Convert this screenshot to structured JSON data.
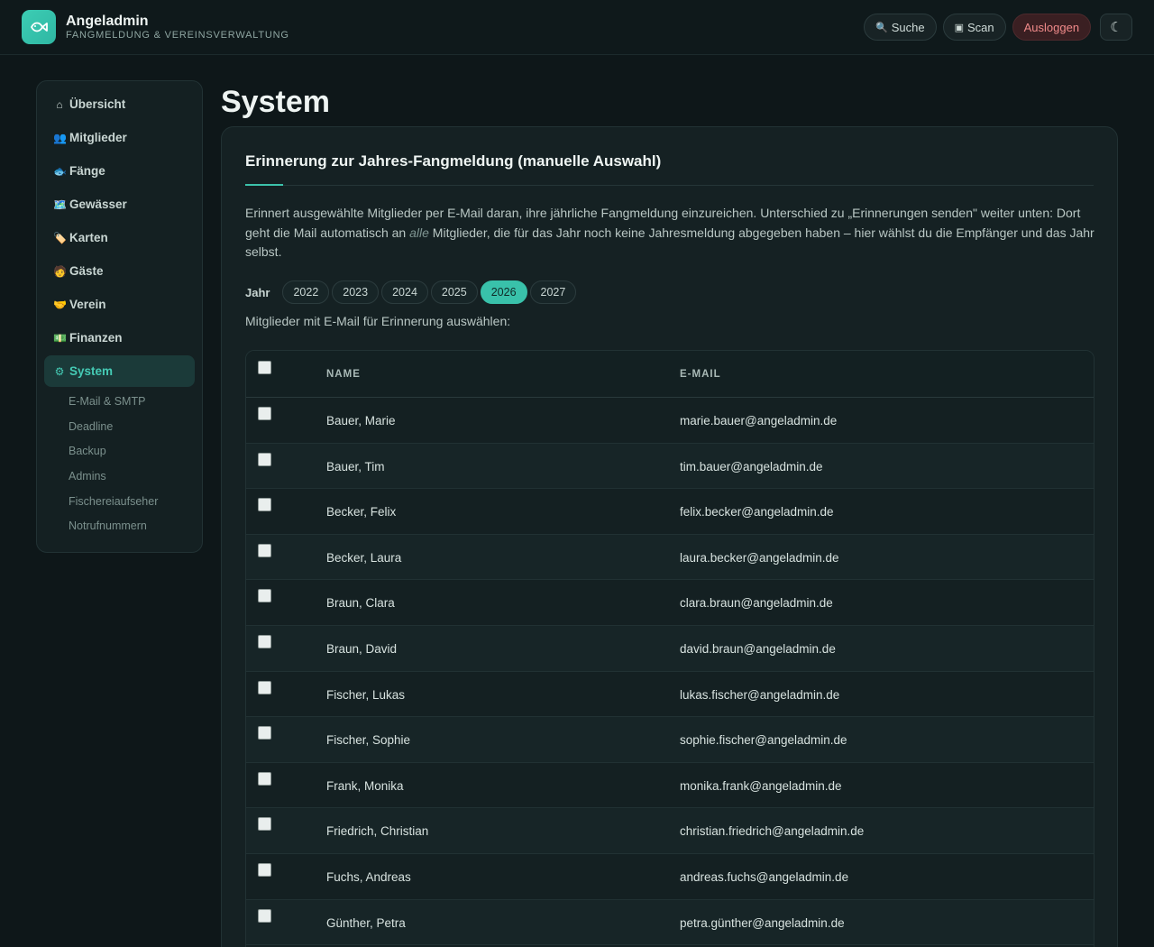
{
  "header": {
    "title": "Angeladmin",
    "subtitle": "FANGMELDUNG & VEREINSVERWALTUNG",
    "buttons": {
      "search": "Suche",
      "scan": "Scan",
      "logout": "Ausloggen"
    },
    "theme_toggle": "☾"
  },
  "sidebar": {
    "items": [
      {
        "icon": "⌂",
        "label": "Übersicht"
      },
      {
        "icon": "👥",
        "label": "Mitglieder"
      },
      {
        "icon": "🐟",
        "label": "Fänge"
      },
      {
        "icon": "🗺️",
        "label": "Gewässer"
      },
      {
        "icon": "🏷️",
        "label": "Karten"
      },
      {
        "icon": "🧑",
        "label": "Gäste"
      },
      {
        "icon": "🤝",
        "label": "Verein"
      },
      {
        "icon": "💵",
        "label": "Finanzen"
      },
      {
        "icon": "⚙",
        "label": "System"
      }
    ],
    "subitems": [
      "E-Mail & SMTP",
      "Deadline",
      "Backup",
      "Admins",
      "Fischereiaufseher",
      "Notrufnummern"
    ]
  },
  "page": {
    "title": "System",
    "card_title": "Erinnerung zur Jahres-Fangmeldung (manuelle Auswahl)",
    "desc_part1": "Erinnert ausgewählte Mitglieder per E-Mail daran, ihre jährliche Fangmeldung einzureichen. Unterschied zu „Erinnerungen senden\" weiter unten: Dort geht die Mail automatisch an ",
    "desc_em": "alle",
    "desc_part2": " Mitglieder, die für das Jahr noch keine Jahresmeldung abgegeben haben – hier wählst du die Empfänger und das Jahr selbst.",
    "year_label": "Jahr",
    "years": [
      "2022",
      "2023",
      "2024",
      "2025",
      "2026",
      "2027"
    ],
    "selected_year": "2026",
    "select_hint": "Mitglieder mit E-Mail für Erinnerung auswählen:",
    "columns": {
      "name": "NAME",
      "email": "E-MAIL"
    },
    "rows": [
      {
        "name": "Bauer, Marie",
        "email": "marie.bauer@angeladmin.de"
      },
      {
        "name": "Bauer, Tim",
        "email": "tim.bauer@angeladmin.de"
      },
      {
        "name": "Becker, Felix",
        "email": "felix.becker@angeladmin.de"
      },
      {
        "name": "Becker, Laura",
        "email": "laura.becker@angeladmin.de"
      },
      {
        "name": "Braun, Clara",
        "email": "clara.braun@angeladmin.de"
      },
      {
        "name": "Braun, David",
        "email": "david.braun@angeladmin.de"
      },
      {
        "name": "Fischer, Lukas",
        "email": "lukas.fischer@angeladmin.de"
      },
      {
        "name": "Fischer, Sophie",
        "email": "sophie.fischer@angeladmin.de"
      },
      {
        "name": "Frank, Monika",
        "email": "monika.frank@angeladmin.de"
      },
      {
        "name": "Friedrich, Christian",
        "email": "christian.friedrich@angeladmin.de"
      },
      {
        "name": "Fuchs, Andreas",
        "email": "andreas.fuchs@angeladmin.de"
      },
      {
        "name": "Günther, Petra",
        "email": "petra.günther@angeladmin.de"
      }
    ]
  },
  "colors": {
    "accent": "#39c1aa",
    "danger": "#f08a8a",
    "background": "#0e1719"
  }
}
